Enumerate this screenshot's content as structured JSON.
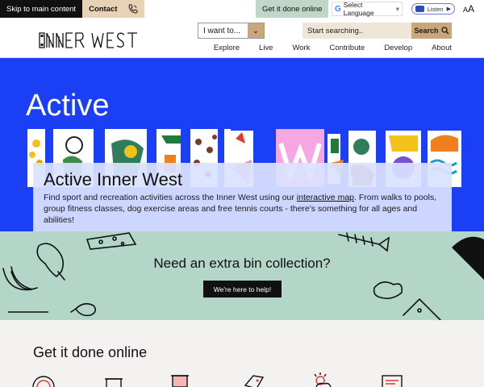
{
  "utility": {
    "skip_label": "Skip to main content",
    "contact_label": "Contact",
    "get_it_done_label": "Get it done online",
    "language_label": "Select Language",
    "listen_label": "Listen",
    "text_size_label": "A",
    "text_size_small": "A"
  },
  "header": {
    "logo_text": "INNER WEST",
    "i_want_to": "I want to...",
    "search_placeholder": "Start searching..",
    "search_button": "Search",
    "nav": [
      "Explore",
      "Live",
      "Work",
      "Contribute",
      "Develop",
      "About"
    ]
  },
  "hero": {
    "active_word": "Active",
    "title": "Active Inner West",
    "description_before": "Find sport and recreation activities across the Inner West using our ",
    "description_link": "interactive map",
    "description_after": ". From walks to pools, group fitness classes, dog exercise areas and free tennis courts - there's something for all ages and abilities!"
  },
  "bin_banner": {
    "heading": "Need an extra bin collection?",
    "cta": "We're here to help!"
  },
  "get_it_done": {
    "heading": "Get it done online"
  },
  "colors": {
    "hero_blue": "#1b3ff5",
    "bin_green": "#b3d6c9",
    "tan": "#c9a77a",
    "contact_tan": "#e8d2b5",
    "get_done_green": "#bfd7c8"
  }
}
